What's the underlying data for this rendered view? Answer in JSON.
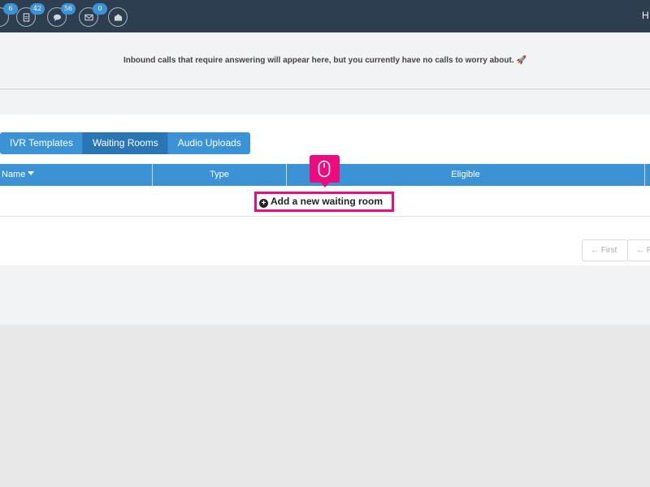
{
  "topbar": {
    "badges": [
      "6",
      "42",
      "56",
      "0"
    ],
    "user_initial": "H",
    "icons": [
      "user-icon",
      "document-icon",
      "chat-icon",
      "mail-icon",
      "envelope-open-icon"
    ]
  },
  "notice": {
    "text": "Inbound calls that require answering will appear here, but you currently have no calls to worry about.",
    "emoji": "🚀"
  },
  "tabs": [
    {
      "label": "IVR Templates",
      "active": false
    },
    {
      "label": "Waiting Rooms",
      "active": true
    },
    {
      "label": "Audio Uploads",
      "active": false
    }
  ],
  "table": {
    "columns": [
      "Name",
      "Type",
      "Eligible"
    ],
    "add_label": "Add a new waiting room"
  },
  "pagination": {
    "first_label": "← First",
    "prev_label": "← P"
  },
  "colors": {
    "topbar": "#2c3e50",
    "primary": "#3b93d6",
    "active_tab": "#2a76b4",
    "highlight": "#ec0c7e"
  }
}
